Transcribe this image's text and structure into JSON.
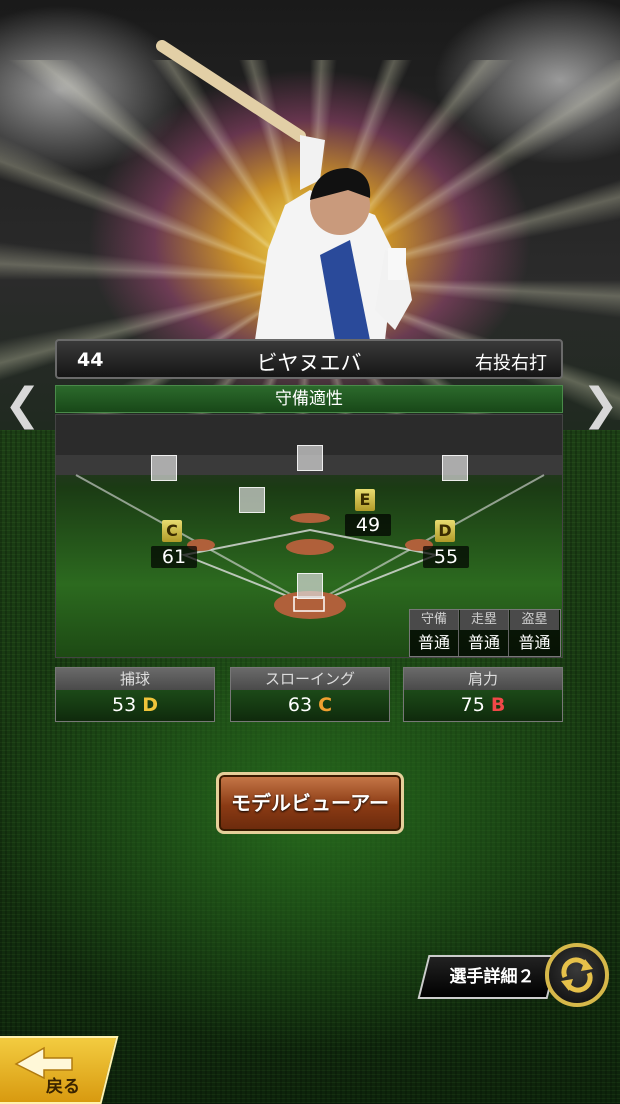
{
  "player": {
    "number": "44",
    "name": "ビヤヌエバ",
    "handedness": "右投右打"
  },
  "defense": {
    "title": "守備適性",
    "positions": [
      {
        "pos": "first_base",
        "grade": "D",
        "value": "55"
      },
      {
        "pos": "second_base",
        "grade": "E",
        "value": "49"
      },
      {
        "pos": "third_base",
        "grade": "C",
        "value": "61"
      }
    ],
    "running": {
      "headers": [
        "守備",
        "走塁",
        "盗塁"
      ],
      "values": [
        "普通",
        "普通",
        "普通"
      ]
    }
  },
  "stats": [
    {
      "label": "捕球",
      "value": "53",
      "rank": "D",
      "rank_color": "#f0c43a"
    },
    {
      "label": "スローイング",
      "value": "63",
      "rank": "C",
      "rank_color": "#f0a030"
    },
    {
      "label": "肩力",
      "value": "75",
      "rank": "B",
      "rank_color": "#f04848"
    }
  ],
  "buttons": {
    "model_viewer": "モデルビューアー",
    "detail": "選手詳細２",
    "back": "戻る"
  },
  "icons": {
    "left": "chevron-left-icon",
    "right": "chevron-right-icon",
    "refresh": "refresh-icon"
  }
}
